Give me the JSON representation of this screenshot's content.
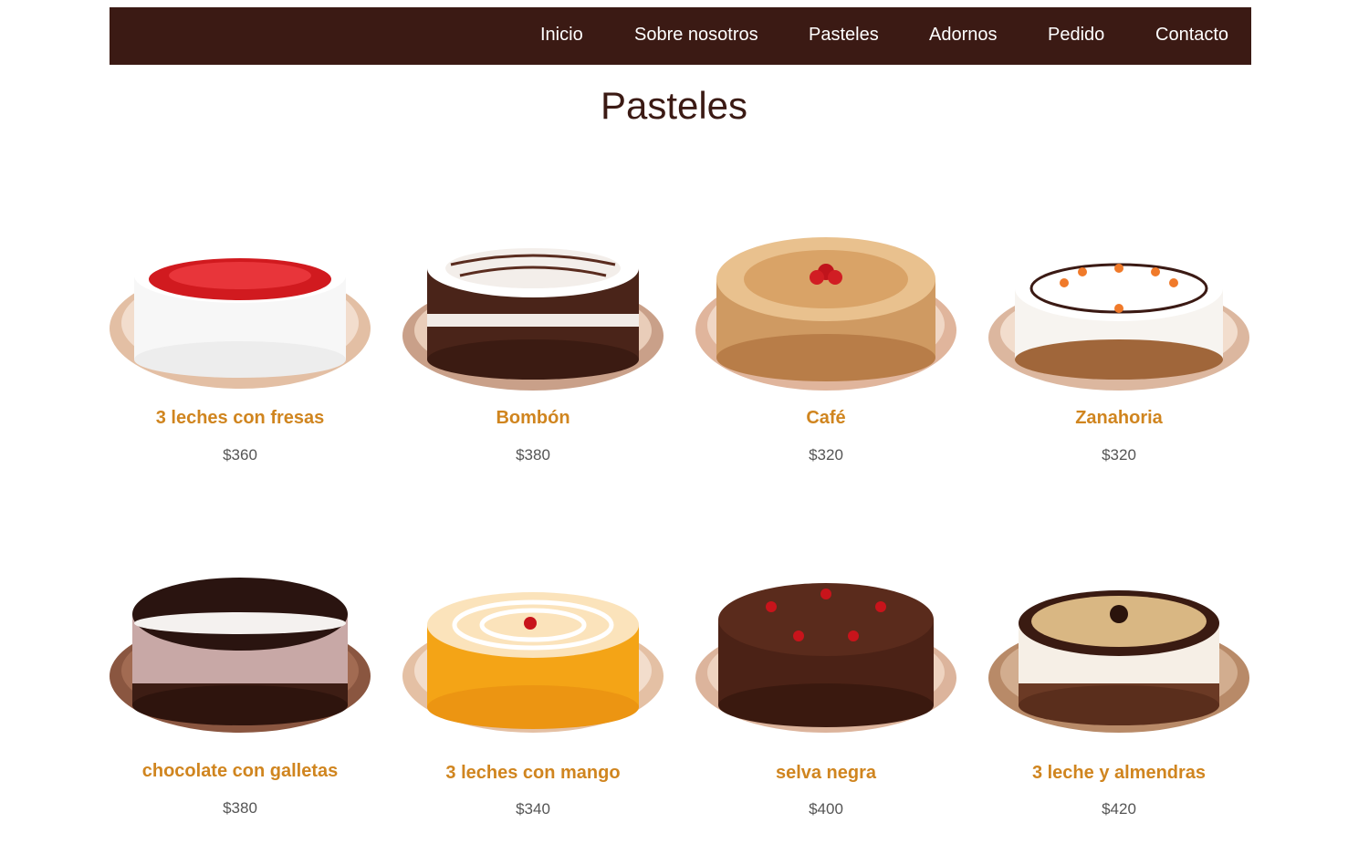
{
  "nav": {
    "items": [
      "Inicio",
      "Sobre nosotros",
      "Pasteles",
      "Adornos",
      "Pedido",
      "Contacto"
    ]
  },
  "page": {
    "title": "Pasteles"
  },
  "cakes": [
    {
      "name": "3 leches con fresas",
      "price": "$360"
    },
    {
      "name": "Bombón",
      "price": "$380"
    },
    {
      "name": "Café",
      "price": "$320"
    },
    {
      "name": "Zanahoria",
      "price": "$320"
    },
    {
      "name": "chocolate con galletas",
      "price": "$380"
    },
    {
      "name": "3 leches con mango",
      "price": "$340"
    },
    {
      "name": "selva negra",
      "price": "$400"
    },
    {
      "name": "3 leche y almendras",
      "price": "$420"
    }
  ],
  "colors": {
    "navbar_bg": "#3b1a14",
    "title": "#3b1a14",
    "cake_name": "#d0851f",
    "price": "#555555"
  }
}
